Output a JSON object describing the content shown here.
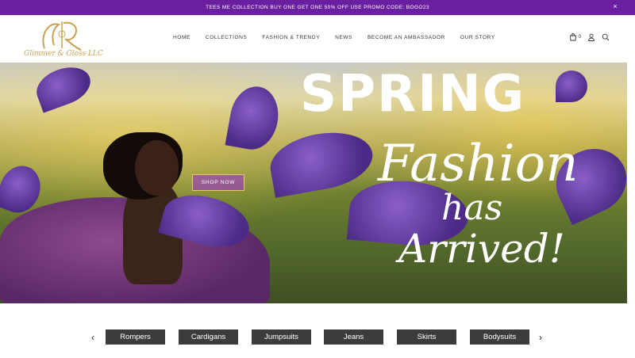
{
  "promo": {
    "text": "TEES ME COLLECTION BUY ONE GET ONE 50% OFF USE PROMO CODE: BOGO23",
    "close_label": "×"
  },
  "brand": {
    "name": "Glimmer & Gloss LLC"
  },
  "nav": {
    "items": [
      {
        "label": "HOME"
      },
      {
        "label": "COLLECTIONS"
      },
      {
        "label": "FASHION & TRENDY"
      },
      {
        "label": "NEWS"
      },
      {
        "label": "BECOME AN AMBASSADOR"
      },
      {
        "label": "OUR STORY"
      }
    ]
  },
  "header_icons": {
    "cart_count": "0",
    "cart_icon": "shopping-bag-icon",
    "account_icon": "user-icon",
    "search_icon": "search-icon"
  },
  "hero": {
    "line1": "SPRING",
    "line2": "Fashion",
    "line3": "has",
    "line4": "Arrived!",
    "cta_label": "SHOP NOW"
  },
  "categories": {
    "prev_label": "‹",
    "next_label": "›",
    "items": [
      {
        "label": "Rompers"
      },
      {
        "label": "Cardigans"
      },
      {
        "label": "Jumpsuits"
      },
      {
        "label": "Jeans"
      },
      {
        "label": "Skirts"
      },
      {
        "label": "Bodysuits"
      }
    ]
  },
  "colors": {
    "promo_bar": "#6a1fa0",
    "logo_gold": "#c9a24e",
    "category_button": "#3c3c3c"
  }
}
